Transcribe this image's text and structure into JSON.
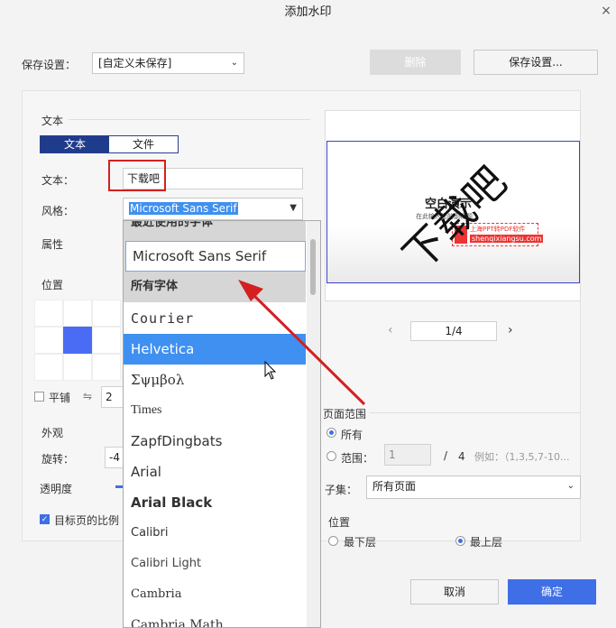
{
  "dialog": {
    "title": "添加水印",
    "close": "×"
  },
  "top": {
    "save_settings_label": "保存设置：",
    "preset_value": "[自定义未保存]",
    "delete_label": "删除",
    "save_settings_btn": "保存设置..."
  },
  "text_section": {
    "heading": "文本",
    "tab_text": "文本",
    "tab_file": "文件",
    "text_label": "文本：",
    "text_value": "下载吧",
    "style_label": "风格：",
    "style_value": "Microsoft Sans Serif",
    "attr_label": "属性"
  },
  "position": {
    "heading": "位置",
    "tile_label": "平铺",
    "tile_value": "2"
  },
  "appearance": {
    "heading": "外观",
    "rotate_label": "旋转：",
    "rotate_value": "-4",
    "opacity_label": "透明度",
    "scale_label": "目标页的比例"
  },
  "font_dropdown": {
    "recent_header": "最近使用的字体",
    "recent_item": "Microsoft Sans Serif",
    "all_header": "所有字体",
    "fonts": [
      "Courier",
      "Helvetica",
      "Σψμβολ",
      "Times",
      "ZapfDingbats",
      "Arial",
      "Arial Black",
      "Calibri",
      "Calibri Light",
      "Cambria",
      "Cambria Math"
    ],
    "selected": "Helvetica"
  },
  "preview": {
    "wm_text": "下载吧",
    "doc_title": "空白演示",
    "doc_sub": "在此输入您的副标题",
    "logo_line1": "上海PPT转PDF软件",
    "logo_line2": "shenqixiangsu.com",
    "page_prev": "‹",
    "page_value": "1/4",
    "page_next": "›"
  },
  "page_range": {
    "heading": "页面范围",
    "all_label": "所有",
    "range_label": "范围：",
    "range_from": "1",
    "range_sep": "/",
    "range_total": "4",
    "range_example": "例如：（1,3,5,7-10...",
    "subset_label": "子集：",
    "subset_value": "所有页面"
  },
  "layer": {
    "heading": "位置",
    "bottom_label": "最下层",
    "top_label": "最上层"
  },
  "footer": {
    "cancel": "取消",
    "ok": "确定"
  },
  "colors": {
    "primary": "#3f6fe6",
    "highlight": "#3f90f0",
    "red": "#d42020",
    "tab_active": "#1f3b8c"
  }
}
